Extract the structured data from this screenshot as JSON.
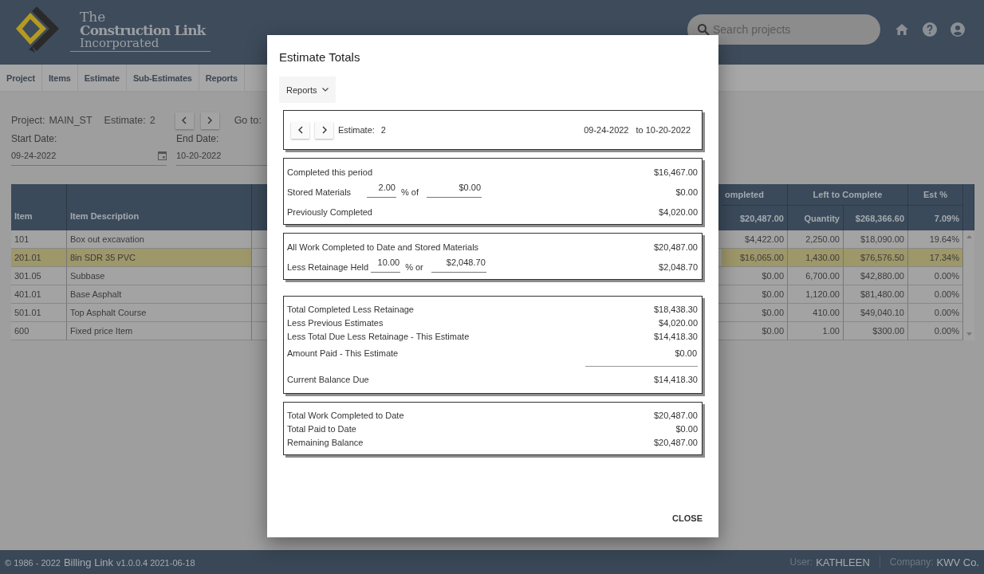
{
  "header": {
    "logo": {
      "line1": "The",
      "line2": "Construction Link",
      "line3": "Incorporated"
    },
    "search": {
      "placeholder": "Search projects"
    }
  },
  "nav_tabs": [
    {
      "label": "Project"
    },
    {
      "label": "Items"
    },
    {
      "label": "Estimate"
    },
    {
      "label": "Sub-Estimates"
    },
    {
      "label": "Reports"
    }
  ],
  "project_bar": {
    "project_label": "Project:",
    "project": "MAIN_ST",
    "estimate_label": "Estimate:",
    "estimate": "2",
    "goto_label": "Go to:"
  },
  "dates": [
    {
      "label": "Start Date:",
      "value": "09-24-2022"
    },
    {
      "label": "End Date:",
      "value": "10-20-2022"
    }
  ],
  "table": {
    "columns": [
      "Item",
      "Item Description"
    ],
    "groups": [
      "ompleted",
      "Left to Complete",
      "Est %"
    ],
    "totals": [
      "$20,487.00",
      "Quantity",
      "$268,366.60",
      "7.09%"
    ],
    "rows": [
      {
        "item": "101",
        "description": "Box out excavation",
        "completed": "$4,422.00",
        "left_quantity": "2,250.00",
        "left_amount": "$18,090.00",
        "est_pct": "19.64%",
        "selected": false
      },
      {
        "item": "201.01",
        "description": "8in SDR 35 PVC",
        "completed": "$16,065.00",
        "left_quantity": "1,430.00",
        "left_amount": "$76,576.50",
        "est_pct": "17.34%",
        "selected": true
      },
      {
        "item": "301.05",
        "description": "Subbase",
        "completed": "$0.00",
        "left_quantity": "6,700.00",
        "left_amount": "$42,880.00",
        "est_pct": "0.00%",
        "selected": false
      },
      {
        "item": "401.01",
        "description": "Base Asphalt",
        "completed": "$0.00",
        "left_quantity": "1,120.00",
        "left_amount": "$81,480.00",
        "est_pct": "0.00%",
        "selected": false
      },
      {
        "item": "501.01",
        "description": "Top Asphalt Course",
        "completed": "$0.00",
        "left_quantity": "410.00",
        "left_amount": "$49,040.10",
        "est_pct": "0.00%",
        "selected": false
      },
      {
        "item": "600",
        "description": "Fixed price Item",
        "completed": "$0.00",
        "left_quantity": "1.00",
        "left_amount": "$300.00",
        "est_pct": "0.00%",
        "selected": false
      }
    ]
  },
  "modal": {
    "title": "Estimate Totals",
    "reports_menu": "Reports",
    "estimate_nav": {
      "label": "Estimate:",
      "estimate": "2",
      "from": "09-24-2022",
      "to": "to 10-20-2022"
    },
    "sections": [
      {
        "rows": [
          {
            "kind": "row",
            "label": "Completed this period",
            "amount": "$16,467.00"
          },
          {
            "kind": "input",
            "label": "Stored Materials",
            "percent": "2.00",
            "connector": "% of",
            "base": "$0.00",
            "amount": "$0.00"
          },
          {
            "kind": "row",
            "label": "Previously Completed",
            "amount": "$4,020.00"
          }
        ]
      },
      {
        "rows": [
          {
            "kind": "row",
            "label": "All Work Completed to Date and Stored Materials",
            "amount": "$20,487.00"
          },
          {
            "kind": "input",
            "label": "Less Retainage Held",
            "percent": "10.00",
            "connector": "% or",
            "base": "$2,048.70",
            "amount": "$2,048.70"
          }
        ]
      },
      {
        "rows": [
          {
            "kind": "tight",
            "label": "Total Completed Less Retainage",
            "amount": "$18,438.30"
          },
          {
            "kind": "tight",
            "label": "Less Previous Estimates",
            "amount": "$4,020.00"
          },
          {
            "kind": "tight",
            "label": "Less Total Due Less Retainage - This Estimate",
            "amount": "$14,418.30"
          },
          {
            "kind": "paid",
            "label": "Amount Paid - This Estimate",
            "amount": "$0.00"
          },
          {
            "kind": "row",
            "label": "Current Balance Due",
            "amount": "$14,418.30"
          }
        ]
      },
      {
        "rows": [
          {
            "kind": "tight",
            "label": "Total Work Completed to Date",
            "amount": "$20,487.00"
          },
          {
            "kind": "tight",
            "label": "Total Paid to Date",
            "amount": "$0.00"
          },
          {
            "kind": "tight",
            "label": "Remaining Balance",
            "amount": "$20,487.00"
          }
        ]
      }
    ],
    "close": "CLOSE"
  },
  "footer": {
    "copyright": "© 1986 - 2022",
    "app": "Billing Link",
    "version": "v1.0.0.4 2021-06-18",
    "user_label": "User:",
    "user": "KATHLEEN",
    "company_label": "Company:",
    "company": "KWV Co."
  }
}
